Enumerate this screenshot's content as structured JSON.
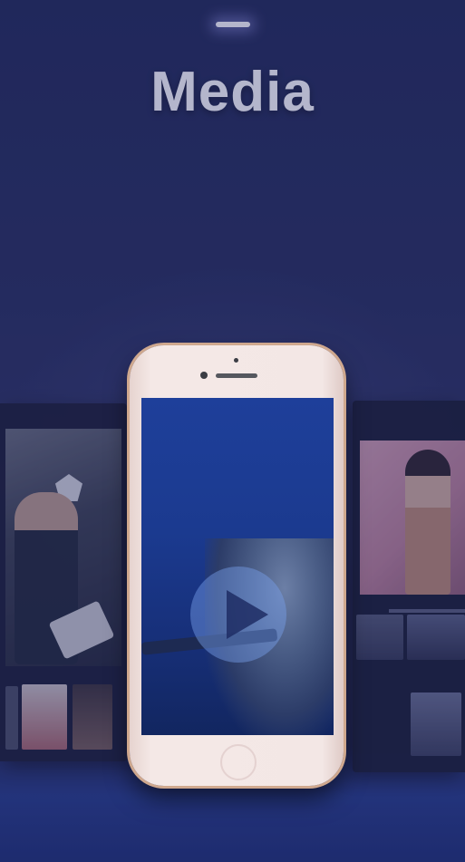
{
  "header": {
    "title": "Media"
  },
  "icons": {
    "handle": "drag-handle-icon",
    "play": "play-icon"
  },
  "colors": {
    "background": "#1c2350",
    "screen": "#1e3f9a",
    "phone_body": "#f4e8e6"
  }
}
